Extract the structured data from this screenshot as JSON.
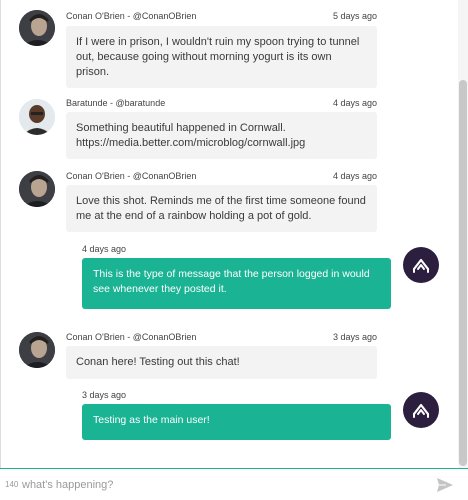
{
  "messages": [
    {
      "author": "Conan O'Brien - @ConanOBrien",
      "time": "5 days ago",
      "text": "If I were in prison, I wouldn't ruin my spoon trying to tunnel out, because going without morning yogurt is its own prison."
    },
    {
      "author": "Baratunde - @baratunde",
      "time": "4 days ago",
      "text": "Something beautiful happened in Cornwall. https://media.better.com/microblog/cornwall.jpg"
    },
    {
      "author": "Conan O'Brien - @ConanOBrien",
      "time": "4 days ago",
      "text": "Love this shot. Reminds me of the first time someone found me at the end of a rainbow holding a pot of gold."
    },
    {
      "own": true,
      "time": "4 days ago",
      "text": "This is the type of message that the person logged in would see whenever they posted it."
    },
    {
      "author": "Conan O'Brien - @ConanOBrien",
      "time": "3 days ago",
      "text": "Conan here! Testing out this chat!"
    },
    {
      "own": true,
      "time": "3 days ago",
      "text": "Testing as the main user!"
    }
  ],
  "composer": {
    "char_count": "140",
    "placeholder": "what's happening?",
    "value": ""
  },
  "icons": {
    "send": "send-icon",
    "own_avatar": "logo-icon"
  },
  "colors": {
    "accent": "#1ab394",
    "own_avatar_bg": "#2c1e3f",
    "incoming_bubble": "#f3f3f3"
  }
}
